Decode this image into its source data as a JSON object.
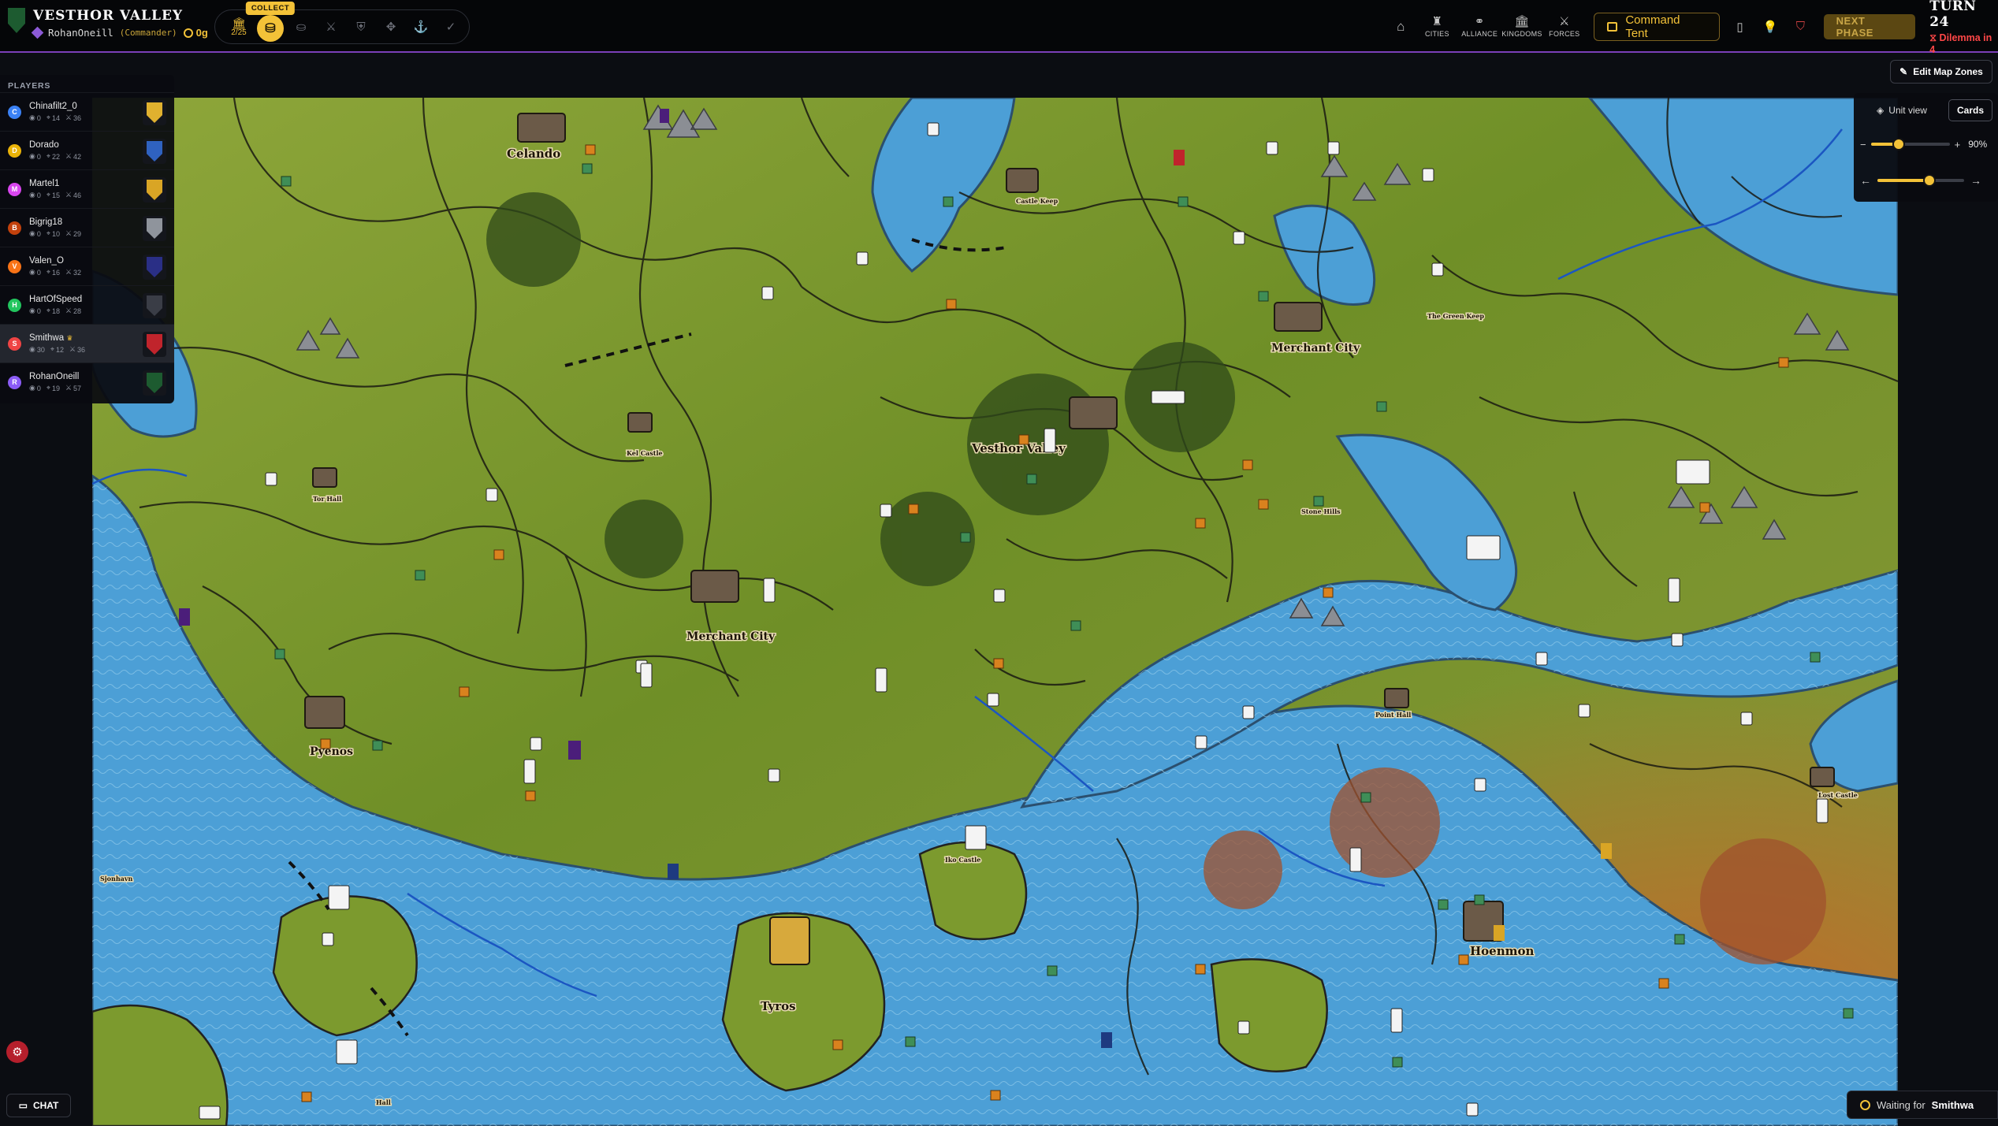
{
  "header": {
    "game_title": "VESTHOR VALLEY",
    "player_name": "RohanOneill",
    "player_role": "(Commander)",
    "gold": "0g"
  },
  "actionbar": {
    "treasury_count": "2/25",
    "collect_label": "COLLECT"
  },
  "nav": {
    "items": [
      {
        "label": "CITIES",
        "icon": "castle-icon"
      },
      {
        "label": "ALLIANCE",
        "icon": "handshake-icon"
      },
      {
        "label": "KINGDOMS",
        "icon": "bank-icon"
      },
      {
        "label": "FORCES",
        "icon": "crossed-swords-icon"
      }
    ],
    "command_tent": "Command Tent",
    "next_phase": "NEXT PHASE",
    "turn": "TURN 24",
    "dilemma": "Dilemma in 4"
  },
  "players_panel": {
    "title": "PLAYERS",
    "players": [
      {
        "initial": "C",
        "name": "Chinafilt2_0",
        "gold": "0",
        "cities": "14",
        "units": "36",
        "color": "#3b82f6",
        "crest": "#e0b12f",
        "active": false
      },
      {
        "initial": "D",
        "name": "Dorado",
        "gold": "0",
        "cities": "22",
        "units": "42",
        "color": "#eab308",
        "crest": "#2f62c0",
        "active": false
      },
      {
        "initial": "M",
        "name": "Martel1",
        "gold": "0",
        "cities": "15",
        "units": "46",
        "color": "#d946ef",
        "crest": "#d9a525",
        "active": false
      },
      {
        "initial": "B",
        "name": "Bigrig18",
        "gold": "0",
        "cities": "10",
        "units": "29",
        "color": "#c2410c",
        "crest": "#8f949c",
        "active": false
      },
      {
        "initial": "V",
        "name": "Valen_O",
        "gold": "0",
        "cities": "16",
        "units": "32",
        "color": "#f97316",
        "crest": "#2a2f86",
        "active": false
      },
      {
        "initial": "H",
        "name": "HartOfSpeed",
        "gold": "0",
        "cities": "18",
        "units": "28",
        "color": "#22c55e",
        "crest": "#3a3d46",
        "active": false
      },
      {
        "initial": "S",
        "name": "Smithwa",
        "gold": "30",
        "cities": "12",
        "units": "36",
        "color": "#ef4444",
        "crest": "#c0242c",
        "active": true
      },
      {
        "initial": "R",
        "name": "RohanOneill",
        "gold": "0",
        "cities": "19",
        "units": "57",
        "color": "#8b5cf6",
        "crest": "#1d5b30",
        "active": false
      }
    ]
  },
  "map": {
    "city_labels": [
      "Celando",
      "Castle Keep",
      "Merchant City",
      "The Green Keep",
      "Vesthor Valley",
      "Kel Castle",
      "Tor Hall",
      "Merchant City",
      "Stone Hills",
      "Pyenos",
      "Sjonhavn",
      "Iko Castle",
      "Tyros",
      "Hoenmon",
      "Lost Castle",
      "Point Hall",
      "Hall"
    ]
  },
  "tools": {
    "edit_zones": "Edit Map Zones",
    "unit_view": "Unit view",
    "cards": "Cards",
    "zoom_percent": "90%",
    "zoom_level": 0.35,
    "rotation_level": 0.6
  },
  "bottom": {
    "chat": "CHAT",
    "waiting_prefix": "Waiting for",
    "waiting_player": "Smithwa"
  }
}
